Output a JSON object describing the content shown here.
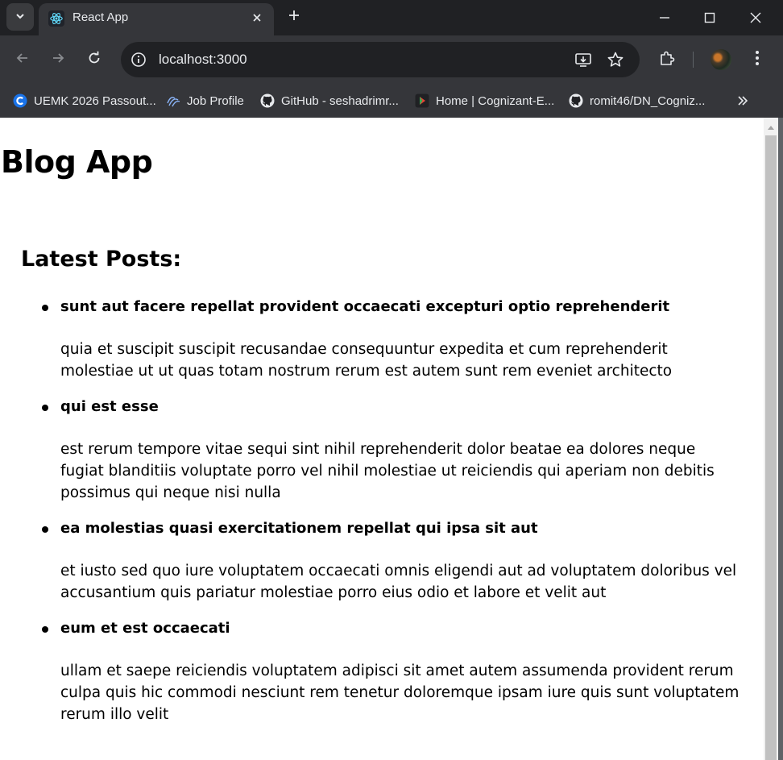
{
  "browser": {
    "tab_title": "React App",
    "url": "localhost:3000",
    "bookmarks": [
      {
        "label": "UEMK 2026 Passout...",
        "icon": "c-circle-icon"
      },
      {
        "label": "Job Profile",
        "icon": "swirl-icon"
      },
      {
        "label": "GitHub - seshadrimr...",
        "icon": "github-icon"
      },
      {
        "label": "Home | Cognizant-E...",
        "icon": "play-icon"
      },
      {
        "label": "romit46/DN_Cogniz...",
        "icon": "github-icon"
      }
    ],
    "colors": {
      "tabstrip": "#202124",
      "toolbar": "#35363a",
      "omnibox": "#202124",
      "text": "#e8eaed"
    }
  },
  "page": {
    "title": "Blog App",
    "section_title": "Latest Posts:",
    "posts": [
      {
        "title": "sunt aut facere repellat provident occaecati excepturi optio reprehenderit",
        "body": "quia et suscipit suscipit recusandae consequuntur expedita et cum reprehenderit molestiae ut ut quas totam nostrum rerum est autem sunt rem eveniet architecto"
      },
      {
        "title": "qui est esse",
        "body": "est rerum tempore vitae sequi sint nihil reprehenderit dolor beatae ea dolores neque fugiat blanditiis voluptate porro vel nihil molestiae ut reiciendis qui aperiam non debitis possimus qui neque nisi nulla"
      },
      {
        "title": "ea molestias quasi exercitationem repellat qui ipsa sit aut",
        "body": "et iusto sed quo iure voluptatem occaecati omnis eligendi aut ad voluptatem doloribus vel accusantium quis pariatur molestiae porro eius odio et labore et velit aut"
      },
      {
        "title": "eum et est occaecati",
        "body": "ullam et saepe reiciendis voluptatem adipisci sit amet autem assumenda provident rerum culpa quis hic commodi nesciunt rem tenetur doloremque ipsam iure quis sunt voluptatem rerum illo velit"
      }
    ]
  }
}
